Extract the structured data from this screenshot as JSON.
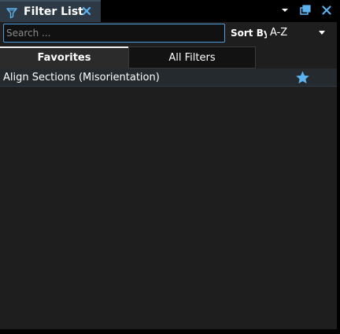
{
  "dock": {
    "title": "Filter List",
    "icons": {
      "filter": "filter-icon",
      "close_tab": "close-icon",
      "menu": "chevron-down-icon",
      "float": "float-window-icon",
      "close": "close-icon"
    }
  },
  "toolbar": {
    "search_placeholder": "Search ...",
    "search_value": "",
    "sort_label": "Sort By",
    "sort_value": "A-Z"
  },
  "tabs": [
    {
      "label": "Favorites",
      "selected": true
    },
    {
      "label": "All Filters",
      "selected": false
    }
  ],
  "favorites": [
    {
      "label": "Align Sections (Misorientation)",
      "icon": "star-icon",
      "favorited": true
    }
  ],
  "colors": {
    "accent": "#4a9ee0",
    "star": "#5bb2ef",
    "panel": "#1e1e1e",
    "tab_active": "#2d3a45"
  }
}
